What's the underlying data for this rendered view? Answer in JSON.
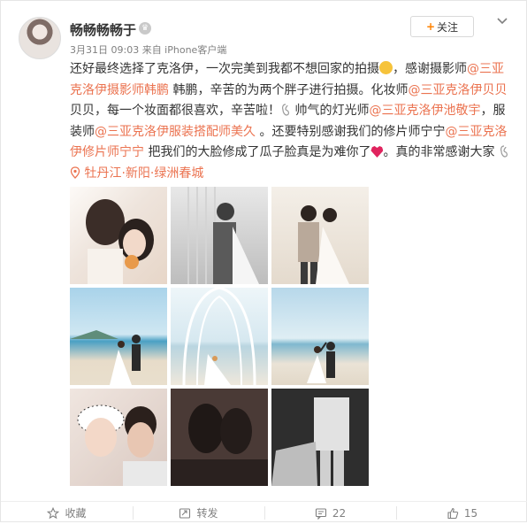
{
  "post": {
    "username": "畅畅畅畅于",
    "vip_badge": "♛",
    "meta": "3月31日 09:03 来自 iPhone客户端",
    "follow_label": "关注",
    "follow_plus": "+",
    "content": {
      "t1": "还好最终选择了克洛伊，一次完美到我都不想回家的拍摄",
      "t2": "，感谢摄影师",
      "m1": "@三亚克洛伊摄影师韩鹏",
      "t3": " 韩鹏，辛苦的为两个胖子进行拍摄。化妆师",
      "m2": "@三亚克洛伊贝贝",
      "t4": " 贝贝，每一个妆面都很喜欢，辛苦啦！",
      "t5": " 帅气的灯光师",
      "m3": "@三亚克洛伊池敬宇",
      "t6": "，服装师",
      "m4": "@三亚克洛伊服装搭配师美久",
      "t7": " 。还要特别感谢我们的修片师宁宁",
      "m5": "@三亚克洛伊修片师宁宁",
      "t8": " 把我们的大脸修成了瓜子脸真是为难你了",
      "t9": "。真的非常感谢大家",
      "location": "牡丹江·新阳·绿洲春城"
    },
    "photos_count": 9
  },
  "footer": {
    "favorite_label": "收藏",
    "repost_label": "转发",
    "comment_count": "22",
    "like_count": "15"
  },
  "colors": {
    "link": "#eb7350",
    "accent": "#ff8200",
    "muted": "#808080"
  },
  "icons": [
    "vip-crown-icon",
    "chevron-down-icon",
    "laugh-emoji-icon",
    "ok-hand-icon",
    "location-pin-icon",
    "heart-emoji-icon",
    "star-icon",
    "repost-icon",
    "comment-icon",
    "like-icon"
  ]
}
